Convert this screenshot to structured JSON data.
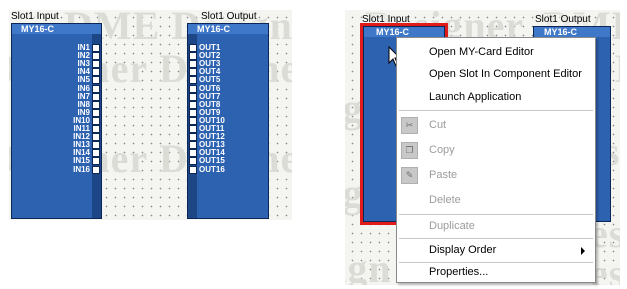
{
  "left_view": {
    "watermark": [
      "DME Designer",
      "Designer",
      "Designer",
      "Designer",
      "Designer"
    ],
    "input": {
      "title": "Slot1 Input",
      "name": "MY16-C",
      "ports": [
        "IN1",
        "IN2",
        "IN3",
        "IN4",
        "IN5",
        "IN6",
        "IN7",
        "IN8",
        "IN9",
        "IN10",
        "IN11",
        "IN12",
        "IN13",
        "IN14",
        "IN15",
        "IN16"
      ]
    },
    "output": {
      "title": "Slot1 Output",
      "name": "MY16-C",
      "ports": [
        "OUT1",
        "OUT2",
        "OUT3",
        "OUT4",
        "OUT5",
        "OUT6",
        "OUT7",
        "OUT8",
        "OUT9",
        "OUT10",
        "OUT11",
        "OUT12",
        "OUT13",
        "OUT14",
        "OUT15",
        "OUT16"
      ]
    }
  },
  "right_view": {
    "watermark": [
      "Designer",
      "DME",
      "esign",
      "DM",
      "esign",
      "esi",
      "esign",
      "esi",
      "esi"
    ],
    "input": {
      "title": "Slot1 Input",
      "name": "MY16-C",
      "selected_color": "#e01b1b"
    },
    "output": {
      "title": "Slot1 Output",
      "name": "MY16-C"
    }
  },
  "context_menu": {
    "items": [
      {
        "label": "Open MY-Card Editor",
        "enabled": true,
        "icon": ""
      },
      {
        "label": "Open Slot In Component Editor",
        "enabled": true,
        "icon": ""
      },
      {
        "label": "Launch Application",
        "enabled": true,
        "icon": ""
      },
      {
        "label": "Cut",
        "enabled": false,
        "icon": "scissors-icon"
      },
      {
        "label": "Copy",
        "enabled": false,
        "icon": "copy-icon"
      },
      {
        "label": "Paste",
        "enabled": false,
        "icon": "paste-icon"
      },
      {
        "label": "Delete",
        "enabled": false,
        "icon": ""
      },
      {
        "label": "Duplicate",
        "enabled": false,
        "icon": ""
      },
      {
        "label": "Display Order",
        "enabled": true,
        "icon": "",
        "submenu": true
      },
      {
        "label": "Properties...",
        "enabled": true,
        "icon": ""
      }
    ]
  },
  "colors": {
    "component_fill": "#2d62b1",
    "component_border": "#0b2657",
    "canvas": "#f4f4f1"
  }
}
